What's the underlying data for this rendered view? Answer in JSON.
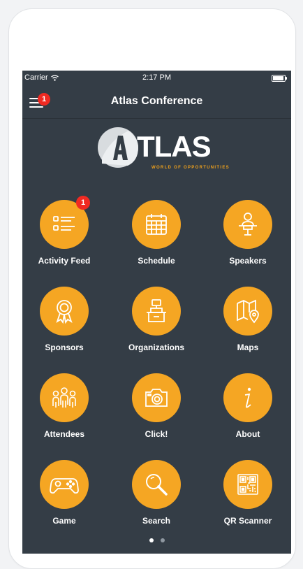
{
  "status": {
    "carrier": "Carrier",
    "time": "2:17 PM"
  },
  "nav": {
    "title": "Atlas Conference",
    "menu_badge": "1"
  },
  "logo": {
    "text": "TLAS",
    "tagline": "WORLD OF OPPORTUNITIES"
  },
  "tiles": [
    {
      "label": "Activity Feed",
      "icon": "activity-feed-icon",
      "badge": "1"
    },
    {
      "label": "Schedule",
      "icon": "calendar-icon"
    },
    {
      "label": "Speakers",
      "icon": "speaker-podium-icon"
    },
    {
      "label": "Sponsors",
      "icon": "award-ribbon-icon"
    },
    {
      "label": "Organizations",
      "icon": "organization-icon"
    },
    {
      "label": "Maps",
      "icon": "map-pin-icon"
    },
    {
      "label": "Attendees",
      "icon": "people-icon"
    },
    {
      "label": "Click!",
      "icon": "camera-icon"
    },
    {
      "label": "About",
      "icon": "info-icon"
    },
    {
      "label": "Game",
      "icon": "gamepad-icon"
    },
    {
      "label": "Search",
      "icon": "search-icon"
    },
    {
      "label": "QR Scanner",
      "icon": "qr-code-icon"
    }
  ],
  "pagination": {
    "pages": 2,
    "current": 1
  },
  "colors": {
    "background": "#343d46",
    "accent": "#f5a623",
    "badge": "#f02a22",
    "text": "#ffffff"
  }
}
